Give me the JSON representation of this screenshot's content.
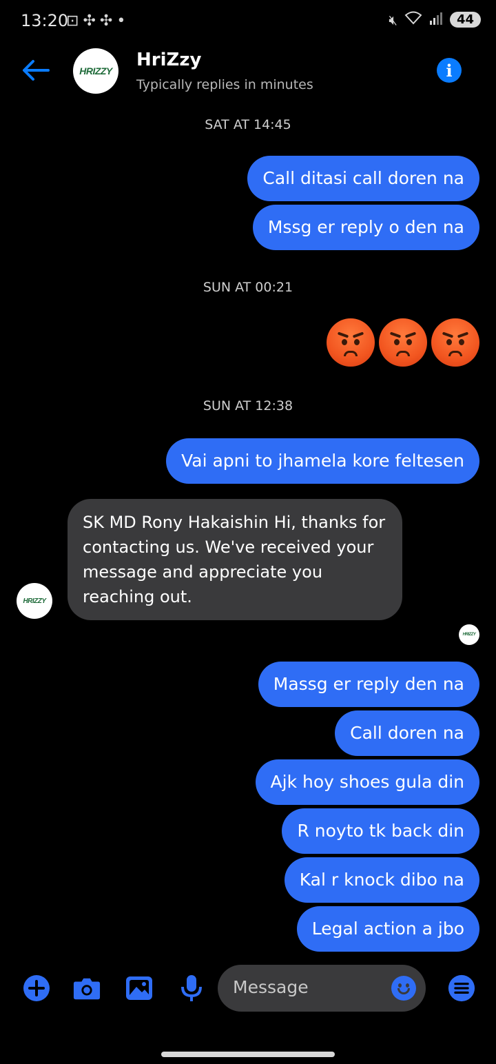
{
  "status_bar": {
    "time": "13:20",
    "battery": "44"
  },
  "header": {
    "title": "HriZzy",
    "subtitle": "Typically replies in minutes",
    "avatar_logo_text": "HRIZZY"
  },
  "timestamps": {
    "t1": "SAT AT 14:45",
    "t2": "SUN AT 00:21",
    "t3": "SUN AT 12:38"
  },
  "messages": {
    "m1": "Call ditasi call doren na",
    "m2": "Mssg er reply o den na",
    "m3": "Vai apni to jhamela kore feltesen",
    "m4": "SK MD Rony Hakaishin Hi, thanks for contacting us. We've received your message and appreciate you reaching out.",
    "m5": "Massg er reply den na",
    "m6": "Call doren na",
    "m7": "Ajk hoy shoes gula din",
    "m8": "R noyto tk back din",
    "m9": "Kal r knock dibo na",
    "m10": "Legal action a jbo"
  },
  "emoji_message": [
    "angry-face",
    "angry-face",
    "angry-face"
  ],
  "composer": {
    "placeholder": "Message"
  },
  "colors": {
    "accent": "#0a7cff",
    "outgoing_bubble": "#2f6df5",
    "incoming_bubble": "#3a3a3c",
    "background": "#000000"
  }
}
